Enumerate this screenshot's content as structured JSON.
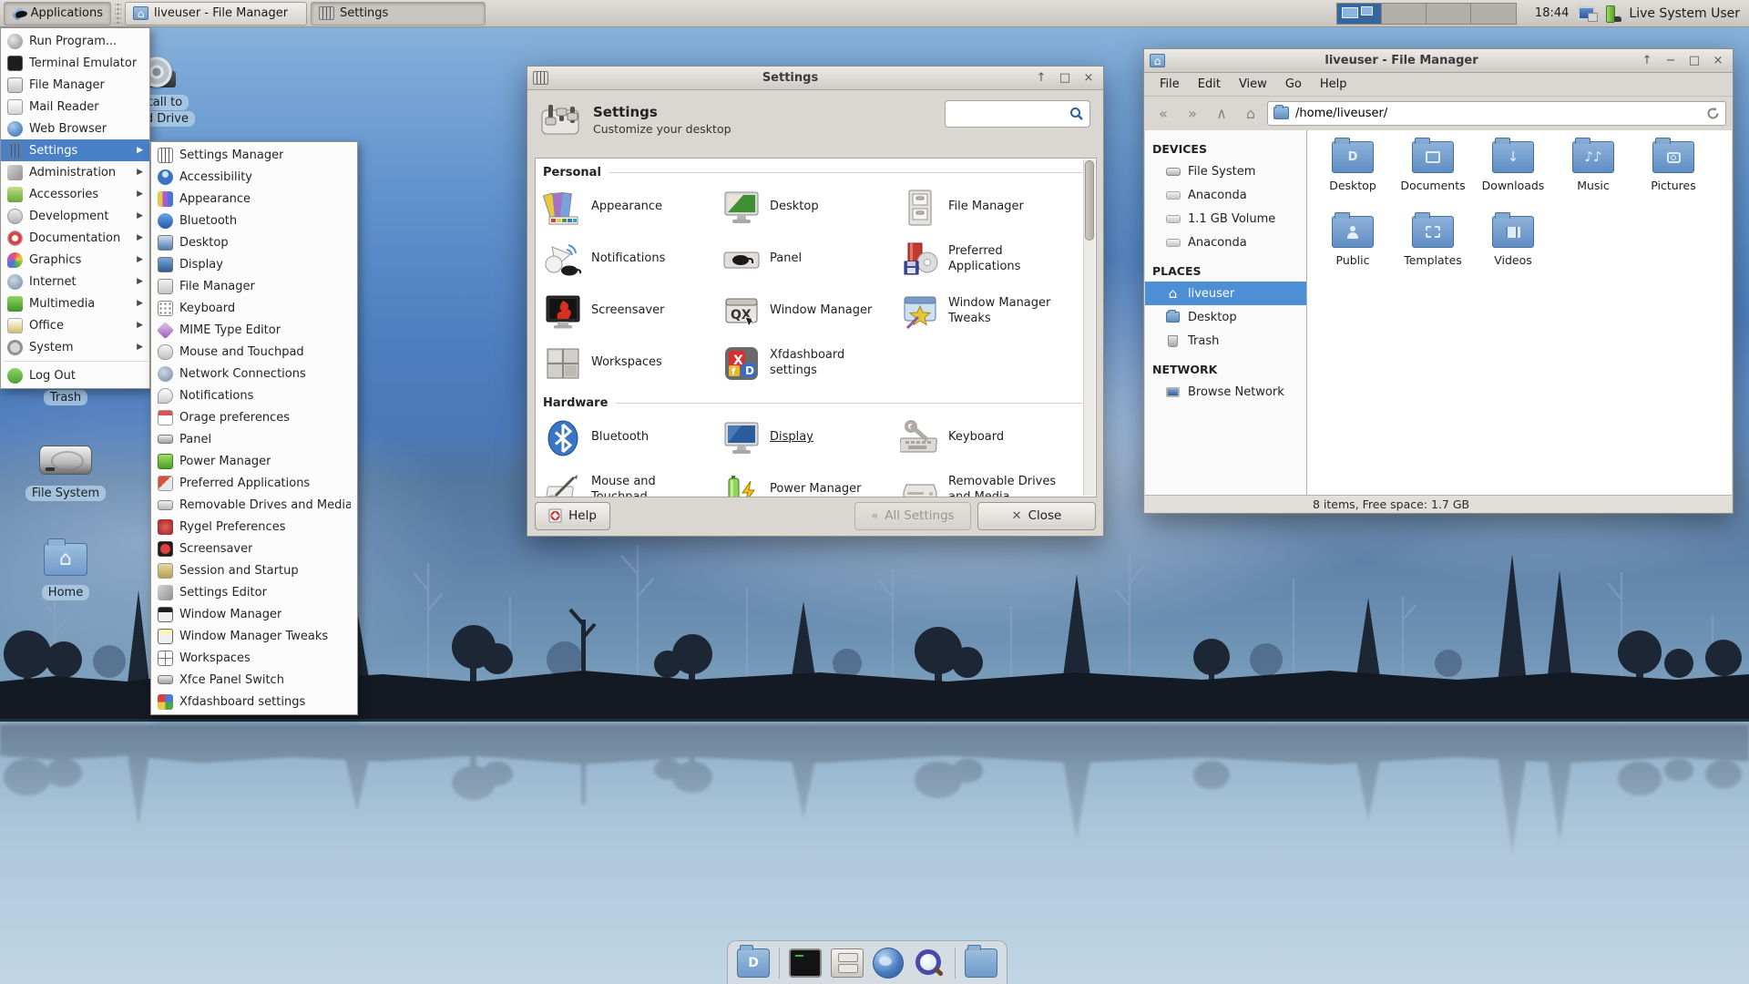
{
  "panel": {
    "applications_label": "Applications",
    "task_buttons": [
      {
        "title": "liveuser - File Manager",
        "icon": "home-folder"
      },
      {
        "title": "Settings",
        "icon": "settings"
      }
    ],
    "workspace_count": 4,
    "clock": "18:44",
    "user_label": "Live System User",
    "tray_icons": [
      "display-settings",
      "battery-power"
    ]
  },
  "applications_menu": {
    "items": [
      {
        "label": "Run Program...",
        "icon": "run"
      },
      {
        "label": "Terminal Emulator",
        "icon": "terminal"
      },
      {
        "label": "File Manager",
        "icon": "file-manager"
      },
      {
        "label": "Mail Reader",
        "icon": "mail"
      },
      {
        "label": "Web Browser",
        "icon": "web-browser"
      },
      {
        "label": "Settings",
        "icon": "settings",
        "submenu": true,
        "selected": true
      },
      {
        "label": "Administration",
        "icon": "administration",
        "submenu": true
      },
      {
        "label": "Accessories",
        "icon": "accessories",
        "submenu": true
      },
      {
        "label": "Development",
        "icon": "development",
        "submenu": true
      },
      {
        "label": "Documentation",
        "icon": "documentation",
        "submenu": true
      },
      {
        "label": "Graphics",
        "icon": "graphics",
        "submenu": true
      },
      {
        "label": "Internet",
        "icon": "internet",
        "submenu": true
      },
      {
        "label": "Multimedia",
        "icon": "multimedia",
        "submenu": true
      },
      {
        "label": "Office",
        "icon": "office",
        "submenu": true
      },
      {
        "label": "System",
        "icon": "system",
        "submenu": true
      },
      {
        "label": "Log Out",
        "icon": "log-out"
      }
    ]
  },
  "settings_submenu": {
    "items": [
      {
        "label": "Settings Manager",
        "icon": "settings-manager"
      },
      {
        "label": "Accessibility",
        "icon": "accessibility"
      },
      {
        "label": "Appearance",
        "icon": "appearance"
      },
      {
        "label": "Bluetooth",
        "icon": "bluetooth"
      },
      {
        "label": "Desktop",
        "icon": "desktop"
      },
      {
        "label": "Display",
        "icon": "display"
      },
      {
        "label": "File Manager",
        "icon": "file-manager"
      },
      {
        "label": "Keyboard",
        "icon": "keyboard"
      },
      {
        "label": "MIME Type Editor",
        "icon": "mime-type"
      },
      {
        "label": "Mouse and Touchpad",
        "icon": "mouse-touchpad"
      },
      {
        "label": "Network Connections",
        "icon": "network"
      },
      {
        "label": "Notifications",
        "icon": "notifications"
      },
      {
        "label": "Orage preferences",
        "icon": "orage-calendar"
      },
      {
        "label": "Panel",
        "icon": "panel"
      },
      {
        "label": "Power Manager",
        "icon": "power-manager"
      },
      {
        "label": "Preferred Applications",
        "icon": "preferred-applications"
      },
      {
        "label": "Removable Drives and Media",
        "icon": "removable-drives"
      },
      {
        "label": "Rygel Preferences",
        "icon": "rygel"
      },
      {
        "label": "Screensaver",
        "icon": "screensaver"
      },
      {
        "label": "Session and Startup",
        "icon": "session-startup"
      },
      {
        "label": "Settings Editor",
        "icon": "settings-editor"
      },
      {
        "label": "Window Manager",
        "icon": "window-manager"
      },
      {
        "label": "Window Manager Tweaks",
        "icon": "window-manager-tweaks"
      },
      {
        "label": "Workspaces",
        "icon": "workspaces"
      },
      {
        "label": "Xfce Panel Switch",
        "icon": "panel-switch"
      },
      {
        "label": "Xfdashboard settings",
        "icon": "xfdashboard"
      }
    ]
  },
  "desktop_icons": {
    "install": {
      "label_line1": "Install to",
      "label_line2": "Hard Drive",
      "icon": "installer-disc"
    },
    "trash": {
      "label": "Trash",
      "icon": "trash-can"
    },
    "filesystem": {
      "label": "File System",
      "icon": "hard-disk"
    },
    "home": {
      "label": "Home",
      "icon": "home-folder"
    }
  },
  "settings_window": {
    "title": "Settings",
    "header": {
      "title": "Settings",
      "subtitle": "Customize your desktop"
    },
    "search": {
      "placeholder": ""
    },
    "sections": [
      {
        "title": "Personal",
        "items": [
          {
            "label": "Appearance",
            "icon": "appearance"
          },
          {
            "label": "Desktop",
            "icon": "desktop"
          },
          {
            "label": "File Manager",
            "icon": "file-manager"
          },
          {
            "label": "Notifications",
            "icon": "notifications"
          },
          {
            "label": "Panel",
            "icon": "panel"
          },
          {
            "label": "Preferred Applications",
            "icon": "preferred-applications"
          },
          {
            "label": "Screensaver",
            "icon": "screensaver"
          },
          {
            "label": "Window Manager",
            "icon": "window-manager"
          },
          {
            "label": "Window Manager Tweaks",
            "icon": "window-manager-tweaks"
          },
          {
            "label": "Workspaces",
            "icon": "workspaces"
          },
          {
            "label": "Xfdashboard settings",
            "icon": "xfdashboard"
          }
        ]
      },
      {
        "title": "Hardware",
        "items": [
          {
            "label": "Bluetooth",
            "icon": "bluetooth"
          },
          {
            "label": "Display",
            "icon": "display",
            "focused": true
          },
          {
            "label": "Keyboard",
            "icon": "keyboard"
          },
          {
            "label": "Mouse and Touchpad",
            "icon": "mouse-touchpad"
          },
          {
            "label": "Power Manager",
            "icon": "power-manager"
          },
          {
            "label": "Removable Drives and Media",
            "icon": "removable-drives"
          }
        ]
      }
    ],
    "buttons": {
      "help": "Help",
      "all_settings": "All Settings",
      "close": "Close"
    }
  },
  "file_manager": {
    "title": "liveuser - File Manager",
    "menu_items": [
      "File",
      "Edit",
      "View",
      "Go",
      "Help"
    ],
    "location": "/home/liveuser/",
    "sidebar": {
      "sections": [
        {
          "title": "DEVICES",
          "items": [
            {
              "label": "File System",
              "icon": "hard-disk"
            },
            {
              "label": "Anaconda",
              "icon": "volume"
            },
            {
              "label": "1.1 GB Volume",
              "icon": "volume"
            },
            {
              "label": "Anaconda",
              "icon": "volume"
            }
          ]
        },
        {
          "title": "PLACES",
          "items": [
            {
              "label": "liveuser",
              "icon": "home",
              "selected": true
            },
            {
              "label": "Desktop",
              "icon": "desktop-folder"
            },
            {
              "label": "Trash",
              "icon": "trash"
            }
          ]
        },
        {
          "title": "NETWORK",
          "items": [
            {
              "label": "Browse Network",
              "icon": "network"
            }
          ]
        }
      ]
    },
    "folders": [
      {
        "name": "Desktop",
        "emblem": "desktop-mark"
      },
      {
        "name": "Documents",
        "emblem": "document-page"
      },
      {
        "name": "Downloads",
        "emblem": "download-arrow"
      },
      {
        "name": "Music",
        "emblem": "music-note"
      },
      {
        "name": "Pictures",
        "emblem": "camera"
      },
      {
        "name": "Public",
        "emblem": "person"
      },
      {
        "name": "Templates",
        "emblem": "template-page"
      },
      {
        "name": "Videos",
        "emblem": "film-strip"
      }
    ],
    "statusbar": "8 items, Free space: 1.7 GB"
  },
  "dock": {
    "icons": [
      "desktop-folder",
      "terminal",
      "file-manager",
      "web-browser",
      "application-finder",
      "home-folder"
    ]
  }
}
